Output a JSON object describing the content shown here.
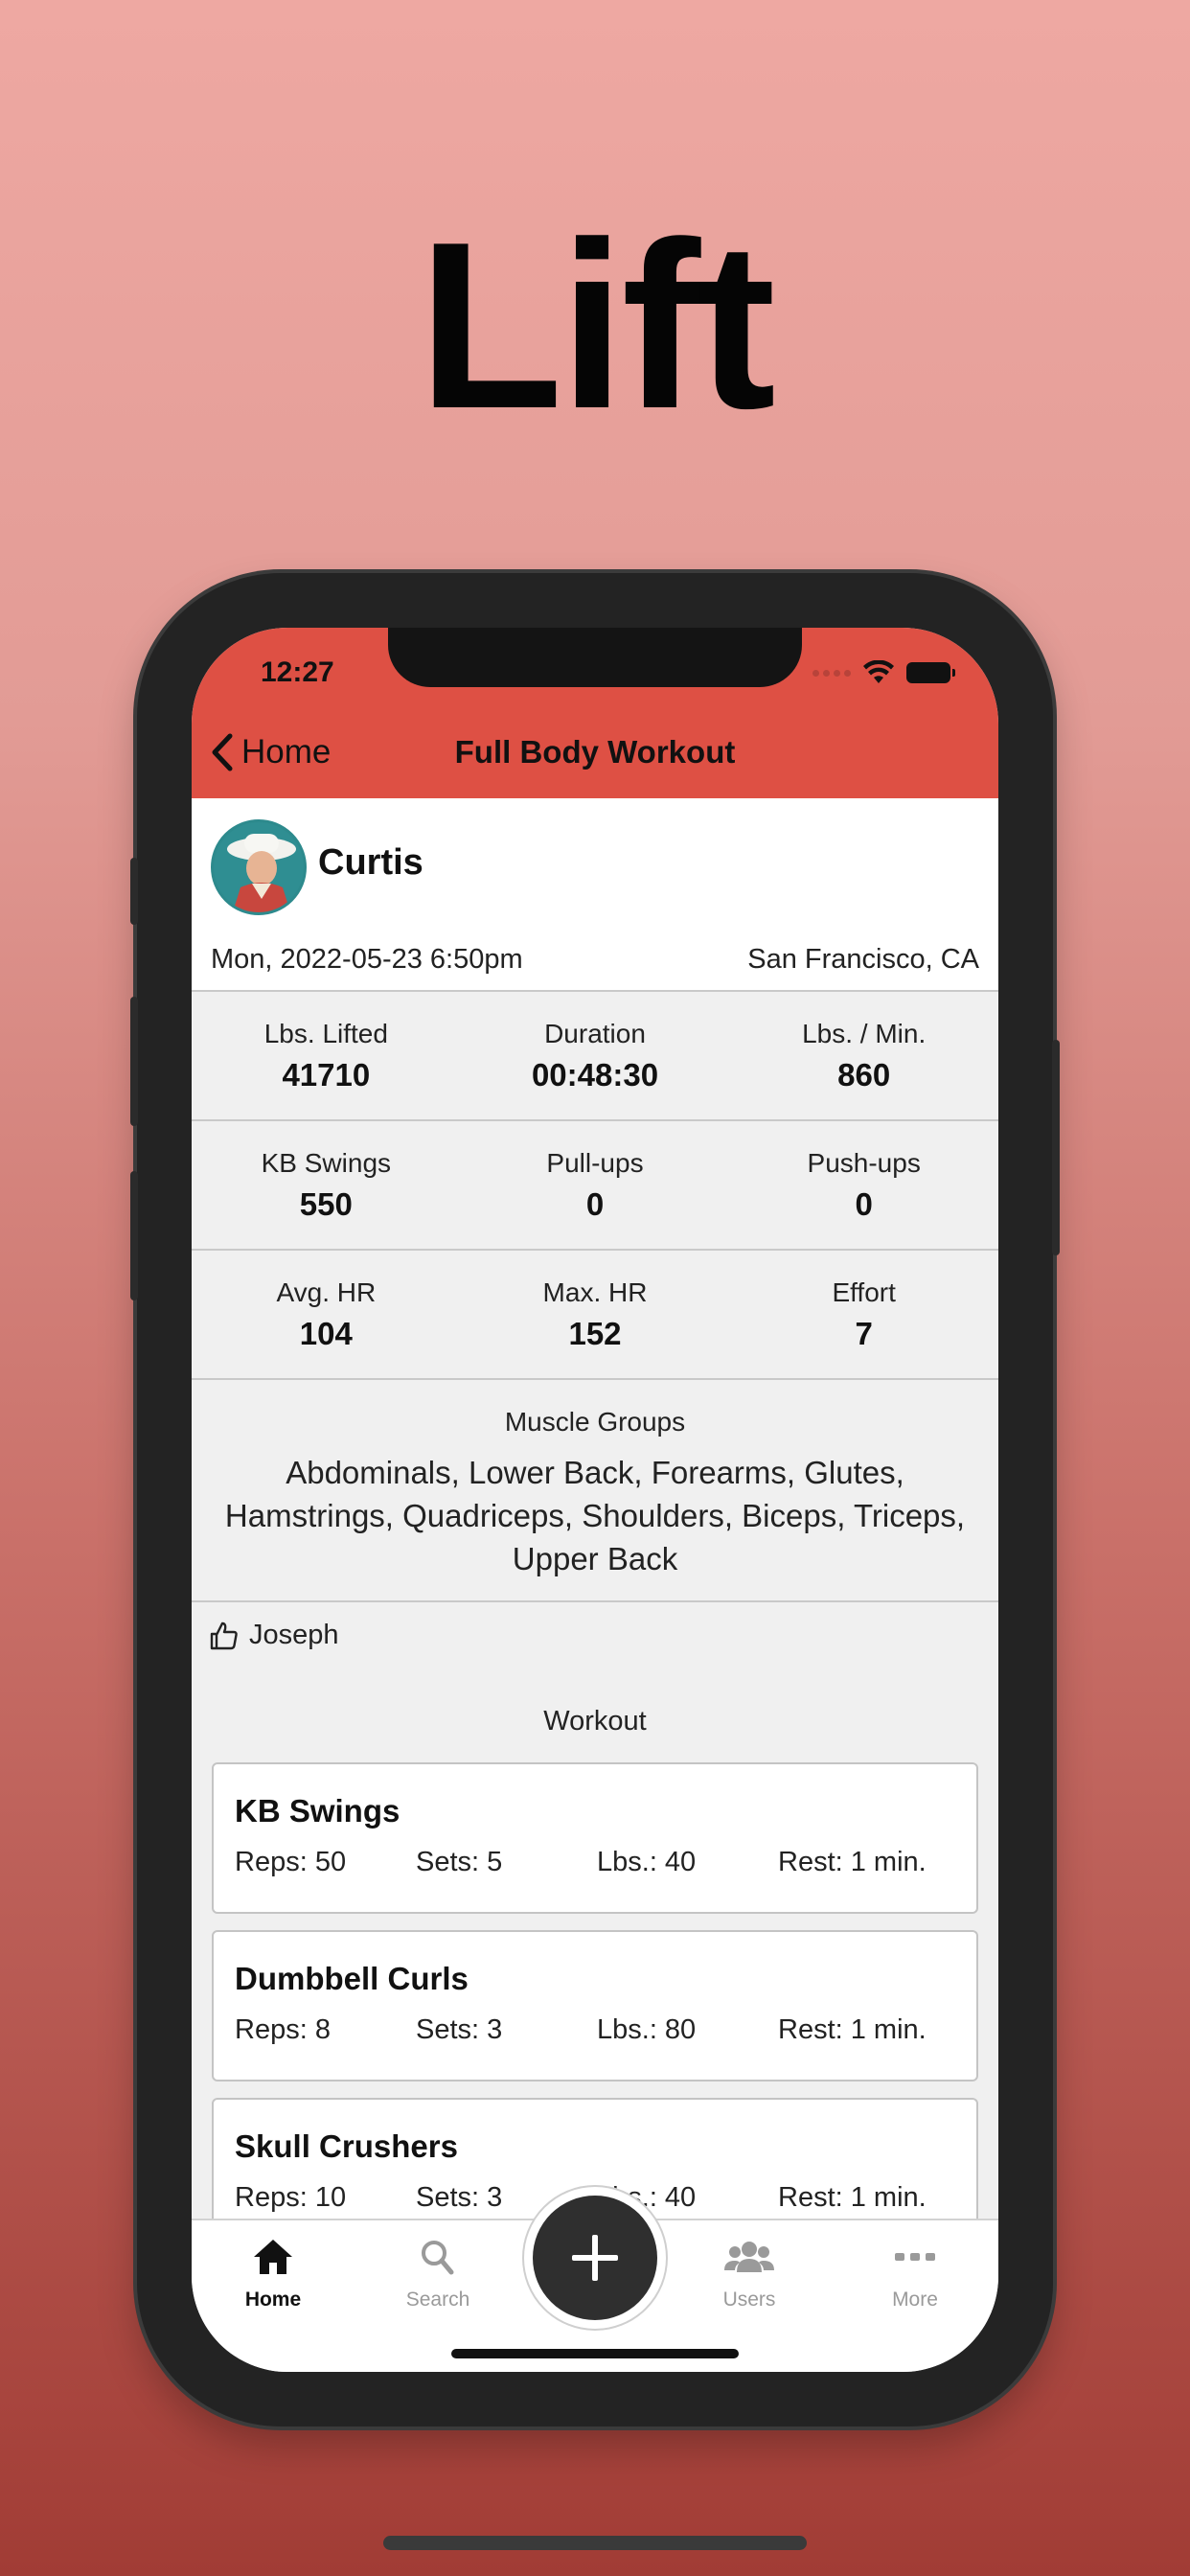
{
  "hero": {
    "title": "Lift"
  },
  "status": {
    "time": "12:27"
  },
  "nav": {
    "back_label": "Home",
    "title": "Full Body Workout"
  },
  "profile": {
    "name": "Curtis",
    "date": "Mon, 2022-05-23 6:50pm",
    "location": "San Francisco, CA"
  },
  "stats": [
    [
      {
        "label": "Lbs. Lifted",
        "value": "41710"
      },
      {
        "label": "Duration",
        "value": "00:48:30"
      },
      {
        "label": "Lbs. / Min.",
        "value": "860"
      }
    ],
    [
      {
        "label": "KB Swings",
        "value": "550"
      },
      {
        "label": "Pull-ups",
        "value": "0"
      },
      {
        "label": "Push-ups",
        "value": "0"
      }
    ],
    [
      {
        "label": "Avg. HR",
        "value": "104"
      },
      {
        "label": "Max. HR",
        "value": "152"
      },
      {
        "label": "Effort",
        "value": "7"
      }
    ]
  ],
  "muscles": {
    "label": "Muscle Groups",
    "list": "Abdominals, Lower Back, Forearms, Glutes, Hamstrings, Quadriceps, Shoulders, Biceps, Triceps, Upper Back"
  },
  "likes": {
    "user": "Joseph"
  },
  "workout": {
    "heading": "Workout",
    "exercises": [
      {
        "name": "KB Swings",
        "reps": "Reps: 50",
        "sets": "Sets: 5",
        "lbs": "Lbs.: 40",
        "rest": "Rest: 1 min."
      },
      {
        "name": "Dumbbell Curls",
        "reps": "Reps: 8",
        "sets": "Sets: 3",
        "lbs": "Lbs.: 80",
        "rest": "Rest: 1 min."
      },
      {
        "name": "Skull Crushers",
        "reps": "Reps: 10",
        "sets": "Sets: 3",
        "lbs": "Lbs.: 40",
        "rest": "Rest: 1 min."
      }
    ]
  },
  "tabs": [
    {
      "label": "Home",
      "icon": "home-icon"
    },
    {
      "label": "Search",
      "icon": "search-icon"
    },
    {
      "label": "Users",
      "icon": "users-icon"
    },
    {
      "label": "More",
      "icon": "more-icon"
    }
  ],
  "colors": {
    "accent": "#de5044",
    "tab_inactive": "#9a9a9a",
    "fab": "#2f2f2f"
  }
}
